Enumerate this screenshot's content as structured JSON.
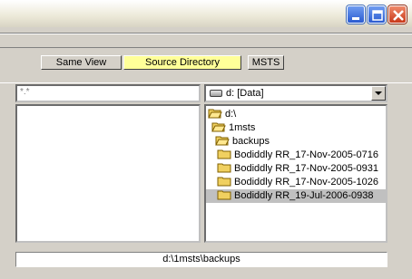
{
  "window": {
    "controls": {
      "minimize": "minimize-icon",
      "maximize": "maximize-icon",
      "close": "close-icon"
    }
  },
  "toolbar": {
    "same_view_label": "Same View",
    "source_directory_label": "Source Directory",
    "msts_label": "MSTS",
    "source_directory_highlight": "#ffff99"
  },
  "filter": {
    "value": "*.*"
  },
  "drive": {
    "icon": "drive-icon",
    "label": "d: [Data]"
  },
  "tree": {
    "items": [
      {
        "label": "d:\\"
      },
      {
        "label": "1msts"
      },
      {
        "label": "backups"
      },
      {
        "label": "Bodiddly RR_17-Nov-2005-0716"
      },
      {
        "label": "Bodiddly RR_17-Nov-2005-0931"
      },
      {
        "label": "Bodiddly RR_17-Nov-2005-1026"
      },
      {
        "label": "Bodiddly RR_19-Jul-2006-0938"
      }
    ],
    "selected_index": 6
  },
  "path": {
    "value": "d:\\1msts\\backups"
  }
}
